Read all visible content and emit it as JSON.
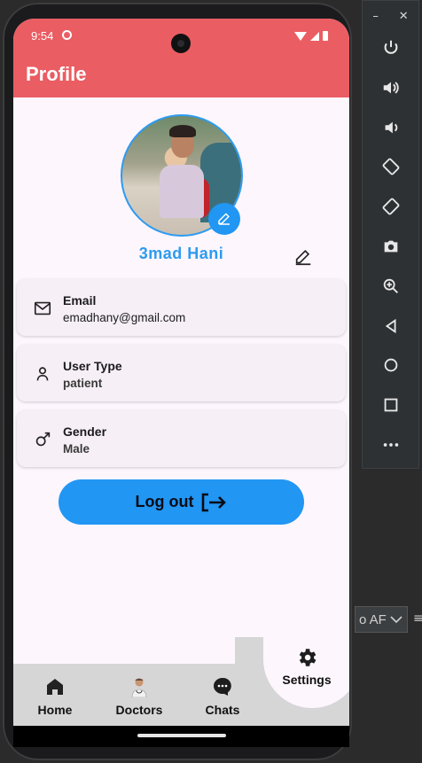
{
  "statusbar": {
    "time": "9:54"
  },
  "appbar": {
    "title": "Profile"
  },
  "profile": {
    "name": "3mad Hani",
    "fields": [
      {
        "label": "Email",
        "value": "emadhany@gmail.com",
        "icon": "mail-icon"
      },
      {
        "label": "User Type",
        "value": "patient",
        "icon": "person-icon"
      },
      {
        "label": "Gender",
        "value": "Male",
        "icon": "male-icon"
      }
    ],
    "logout_label": "Log out"
  },
  "bottomnav": {
    "items": [
      {
        "label": "Home",
        "icon": "home-icon"
      },
      {
        "label": "Doctors",
        "icon": "doctor-icon"
      },
      {
        "label": "Chats",
        "icon": "chat-icon"
      }
    ],
    "settings_label": "Settings"
  },
  "emulator": {
    "controls": [
      "power-icon",
      "volume-up-icon",
      "volume-down-icon",
      "rotate-left-icon",
      "rotate-right-icon",
      "camera-icon",
      "zoom-icon",
      "back-icon",
      "home-circle-icon",
      "overview-icon",
      "more-icon"
    ]
  },
  "side": {
    "dropdown_text": "o AF"
  },
  "colors": {
    "appbar": "#ea5d63",
    "accent": "#2196f3",
    "name": "#2d9bf0"
  }
}
